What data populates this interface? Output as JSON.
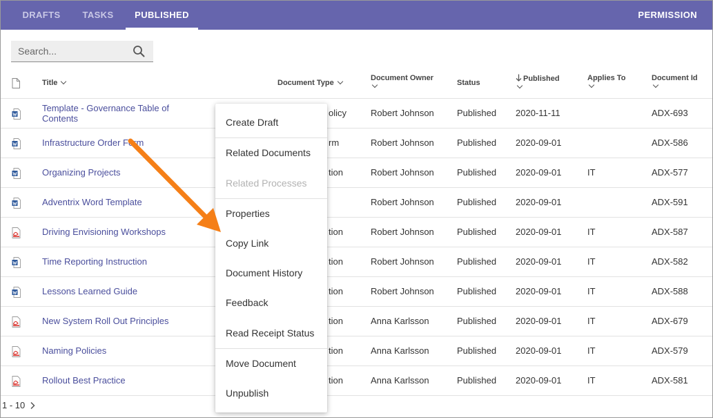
{
  "tabs": [
    {
      "label": "DRAFTS"
    },
    {
      "label": "TASKS"
    },
    {
      "label": "PUBLISHED"
    }
  ],
  "permission_label": "PERMISSION",
  "search": {
    "placeholder": "Search...",
    "value": ""
  },
  "columns": {
    "title": "Title",
    "doc_type": "Document Type",
    "doc_owner": "Document Owner",
    "status": "Status",
    "published": "Published",
    "applies_to": "Applies To",
    "doc_id": "Document Id"
  },
  "rows": [
    {
      "icon": "word-doc-icon",
      "title": "Template - Governance Table of Contents",
      "type": "olicy",
      "owner": "Robert Johnson",
      "status": "Published",
      "published": "2020-11-11",
      "applies": "",
      "id": "ADX-693"
    },
    {
      "icon": "word-doc-icon",
      "title": "Infrastructure Order Form",
      "type": "rm",
      "owner": "Robert Johnson",
      "status": "Published",
      "published": "2020-09-01",
      "applies": "",
      "id": "ADX-586"
    },
    {
      "icon": "word-doc-icon",
      "title": "Organizing Projects",
      "type": "tion",
      "owner": "Robert Johnson",
      "status": "Published",
      "published": "2020-09-01",
      "applies": "IT",
      "id": "ADX-577"
    },
    {
      "icon": "word-doc-icon",
      "title": "Adventrix Word Template",
      "type": "",
      "owner": "Robert Johnson",
      "status": "Published",
      "published": "2020-09-01",
      "applies": "",
      "id": "ADX-591"
    },
    {
      "icon": "pdf-doc-icon",
      "title": "Driving Envisioning Workshops",
      "type": "tion",
      "owner": "Robert Johnson",
      "status": "Published",
      "published": "2020-09-01",
      "applies": "IT",
      "id": "ADX-587"
    },
    {
      "icon": "word-doc-icon",
      "title": "Time Reporting Instruction",
      "type": "tion",
      "owner": "Robert Johnson",
      "status": "Published",
      "published": "2020-09-01",
      "applies": "IT",
      "id": "ADX-582"
    },
    {
      "icon": "word-doc-icon",
      "title": "Lessons Learned Guide",
      "type": "tion",
      "owner": "Robert Johnson",
      "status": "Published",
      "published": "2020-09-01",
      "applies": "IT",
      "id": "ADX-588"
    },
    {
      "icon": "pdf-doc-icon",
      "title": "New System Roll Out Principles",
      "type": "tion",
      "owner": "Anna Karlsson",
      "status": "Published",
      "published": "2020-09-01",
      "applies": "IT",
      "id": "ADX-679"
    },
    {
      "icon": "pdf-doc-icon",
      "title": "Naming Policies",
      "type": "tion",
      "owner": "Anna Karlsson",
      "status": "Published",
      "published": "2020-09-01",
      "applies": "IT",
      "id": "ADX-579"
    },
    {
      "icon": "pdf-doc-icon",
      "title": "Rollout Best Practice",
      "type": "tion",
      "owner": "Anna Karlsson",
      "status": "Published",
      "published": "2020-09-01",
      "applies": "IT",
      "id": "ADX-581"
    }
  ],
  "pagination": {
    "range": "1 - 10"
  },
  "context_menu": {
    "items": [
      {
        "label": "Create Draft",
        "enabled": true
      },
      {
        "label": "Related Documents",
        "enabled": true
      },
      {
        "label": "Related Processes",
        "enabled": false
      },
      {
        "label": "Properties",
        "enabled": true
      },
      {
        "label": "Copy Link",
        "enabled": true
      },
      {
        "label": "Document History",
        "enabled": true
      },
      {
        "label": "Feedback",
        "enabled": true
      },
      {
        "label": "Read Receipt Status",
        "enabled": true
      },
      {
        "label": "Move Document",
        "enabled": true
      },
      {
        "label": "Unpublish",
        "enabled": true
      }
    ]
  },
  "colors": {
    "topbar": "#6665ad",
    "link": "#4a4e9c",
    "arrow": "#f57f17",
    "word_icon": "#2b579a",
    "pdf_icon": "#d9312b"
  }
}
